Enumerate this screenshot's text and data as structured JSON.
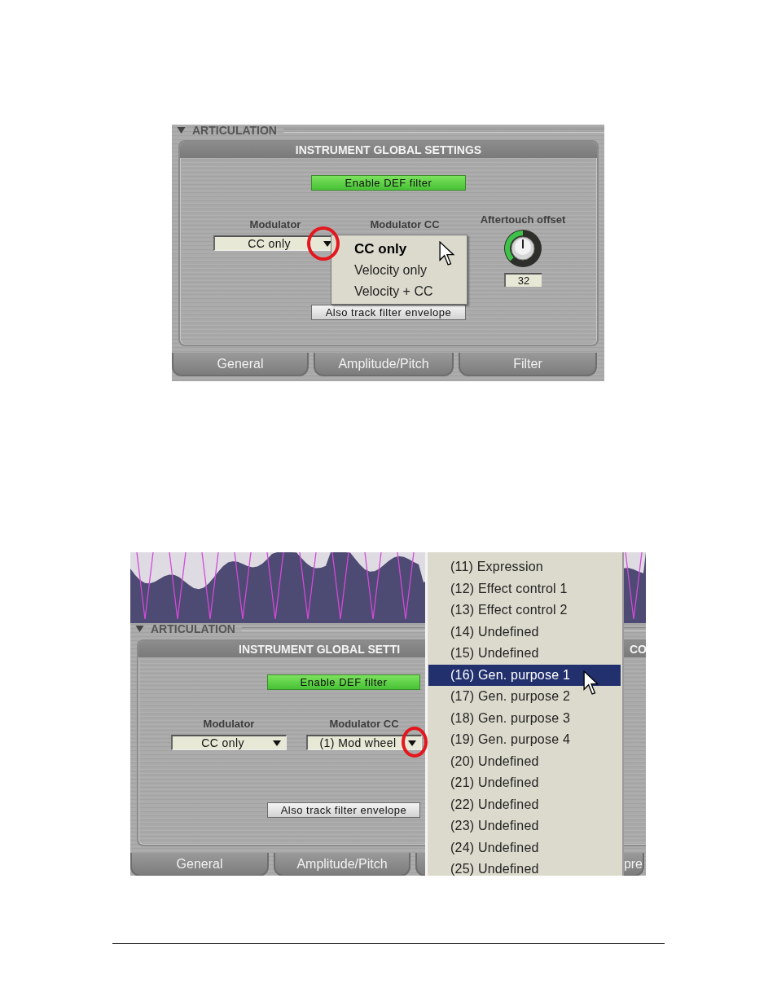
{
  "screenshot_1": {
    "section": {
      "label": "ARTICULATION",
      "expanded": true
    },
    "panel_title": "INSTRUMENT GLOBAL SETTINGS",
    "enable_button": "Enable DEF filter",
    "modulator": {
      "label": "Modulator",
      "value": "CC only"
    },
    "modulator_cc": {
      "label": "Modulator CC"
    },
    "aftertouch": {
      "label": "Aftertouch offset",
      "value": "32"
    },
    "track_button": "Also track filter envelope",
    "tabs": [
      {
        "label": "General"
      },
      {
        "label": "Amplitude/Pitch"
      },
      {
        "label": "Filter"
      }
    ],
    "dropdown_menu": [
      {
        "label": "CC only",
        "selected": true
      },
      {
        "label": "Velocity only",
        "selected": false
      },
      {
        "label": "Velocity + CC",
        "selected": false
      }
    ]
  },
  "screenshot_2": {
    "section": {
      "label": "ARTICULATION",
      "expanded": true
    },
    "panel_title": "INSTRUMENT GLOBAL SETTI",
    "panel_title_right": "CO",
    "enable_button": "Enable DEF filter",
    "modulator": {
      "label": "Modulator",
      "value": "CC only"
    },
    "modulator_cc": {
      "label": "Modulator CC",
      "value": "(1) Mod wheel"
    },
    "track_button": "Also track filter envelope",
    "tabs": [
      {
        "label": "General"
      },
      {
        "label": "Amplitude/Pitch"
      },
      {
        "label": "pre"
      }
    ],
    "dropdown_menu": [
      {
        "label": "(11) Expression",
        "selected": false
      },
      {
        "label": "(12) Effect control 1",
        "selected": false
      },
      {
        "label": "(13) Effect control 2",
        "selected": false
      },
      {
        "label": "(14) Undefined",
        "selected": false
      },
      {
        "label": "(15) Undefined",
        "selected": false
      },
      {
        "label": "(16) Gen. purpose 1",
        "selected": true
      },
      {
        "label": "(17) Gen. purpose 2",
        "selected": false
      },
      {
        "label": "(18) Gen. purpose 3",
        "selected": false
      },
      {
        "label": "(19) Gen. purpose 4",
        "selected": false
      },
      {
        "label": "(20) Undefined",
        "selected": false
      },
      {
        "label": "(21) Undefined",
        "selected": false
      },
      {
        "label": "(22) Undefined",
        "selected": false
      },
      {
        "label": "(23) Undefined",
        "selected": false
      },
      {
        "label": "(24) Undefined",
        "selected": false
      },
      {
        "label": "(25) Undefined",
        "selected": false
      }
    ]
  }
}
